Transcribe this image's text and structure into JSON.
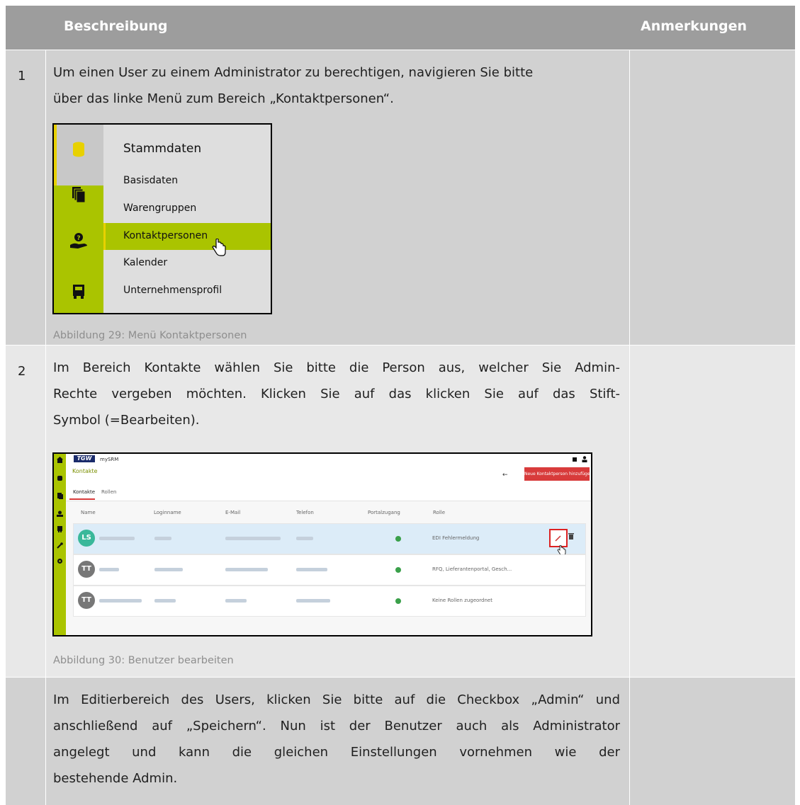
{
  "header": {
    "col_description": "Beschreibung",
    "col_notes": "Anmerkungen"
  },
  "steps": [
    {
      "number": "1",
      "lines": [
        "Um einen User zu einem Administrator zu berechtigen, navigieren Sie bitte",
        "über das linke Menü zum Bereich „Kontaktpersonen“."
      ],
      "caption": "Abbildung 29: Menü Kontaktpersonen"
    },
    {
      "number": "2",
      "lines": [
        "Im Bereich Kontakte wählen Sie bitte die Person aus, welcher Sie Admin-",
        "Rechte vergeben möchten. Klicken Sie auf das  klicken Sie auf das Stift-",
        "Symbol (=Bearbeiten)."
      ],
      "caption": "Abbildung 30: Benutzer bearbeiten"
    },
    {
      "number": "",
      "lines": [
        "Im Editierbereich des Users, klicken Sie bitte auf die Checkbox „Admin“ und",
        "anschließend auf „Speichern“. Nun ist der Benutzer auch als Administrator",
        "angelegt und kann die gleichen Einstellungen vornehmen wie der",
        "bestehende Admin."
      ]
    }
  ],
  "menu_figure": {
    "title": "Stammdaten",
    "items": [
      "Basisdaten",
      "Warengruppen",
      "Kontaktpersonen",
      "Kalender",
      "Unternehmensprofil"
    ],
    "highlighted": "Kontaktpersonen"
  },
  "contacts_figure": {
    "logo": "TGW",
    "app_name": "mySRM",
    "page_title": "Kontakte",
    "add_button": "Neue Kontaktperson hinzufügen",
    "back_arrow": "←",
    "tabs": [
      "Kontakte",
      "Rollen"
    ],
    "columns": [
      "Name",
      "Loginname",
      "E-Mail",
      "Telefon",
      "Portalzugang",
      "Rolle"
    ],
    "rows": [
      {
        "initials": "LS",
        "role": "EDI Fehlermeldung",
        "selected": true
      },
      {
        "initials": "TT",
        "role": "RFQ, Lieferantenportal, Gesch...",
        "selected": false
      },
      {
        "initials": "TT",
        "role": "Keine Rollen zugeordnet",
        "selected": false
      }
    ]
  },
  "colors": {
    "header_bg": "#9d9d9d",
    "accent_green": "#aac400",
    "danger_red": "#d83b3b"
  }
}
